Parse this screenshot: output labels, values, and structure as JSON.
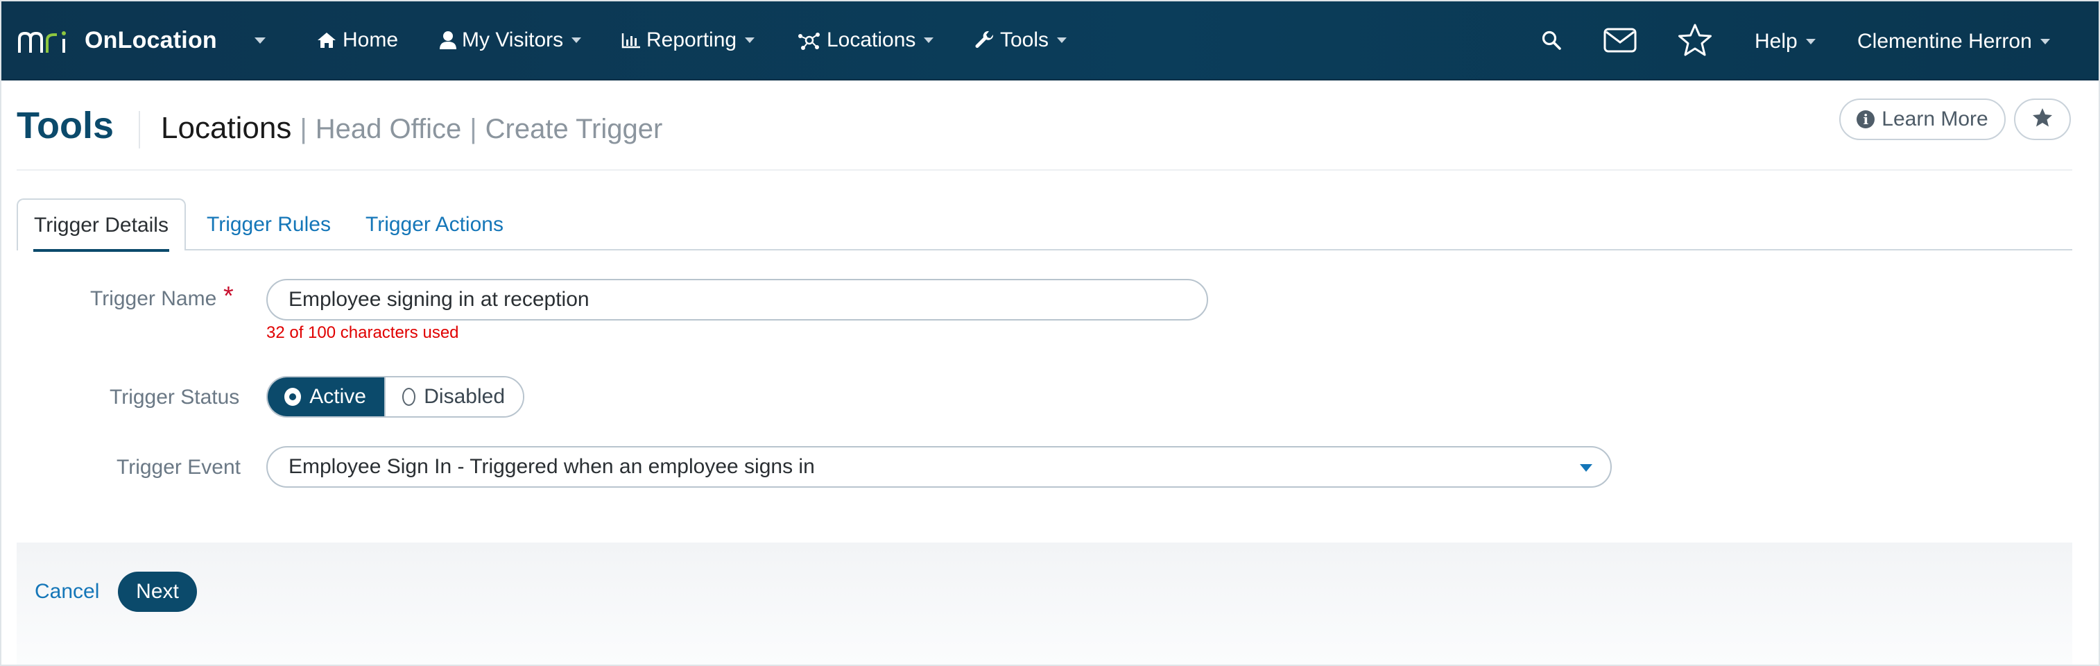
{
  "nav": {
    "brand": "OnLocation",
    "items": [
      {
        "label": "Home",
        "icon": "home-icon"
      },
      {
        "label": "My Visitors",
        "icon": "user-icon"
      },
      {
        "label": "Reporting",
        "icon": "bar-chart-icon"
      },
      {
        "label": "Locations",
        "icon": "network-icon"
      },
      {
        "label": "Tools",
        "icon": "wrench-icon"
      }
    ],
    "help": "Help",
    "user": "Clementine Herron"
  },
  "header": {
    "title": "Tools",
    "breadcrumb_main": "Locations",
    "breadcrumb_sub1": "Head Office",
    "breadcrumb_sub2": "Create Trigger",
    "learn_more": "Learn More"
  },
  "tabs": [
    {
      "label": "Trigger Details",
      "active": true
    },
    {
      "label": "Trigger Rules",
      "active": false
    },
    {
      "label": "Trigger Actions",
      "active": false
    }
  ],
  "form": {
    "name_label": "Trigger Name",
    "name_value": "Employee signing in at reception",
    "name_counter": "32 of 100 characters used",
    "status_label": "Trigger Status",
    "status_active": "Active",
    "status_disabled": "Disabled",
    "event_label": "Trigger Event",
    "event_value": "Employee Sign In - Triggered when an employee signs in"
  },
  "footer": {
    "cancel": "Cancel",
    "next": "Next"
  },
  "colors": {
    "nav_bg": "#0b3d5a",
    "accent": "#0b4a6b",
    "link": "#1476b8",
    "error": "#e00000"
  }
}
